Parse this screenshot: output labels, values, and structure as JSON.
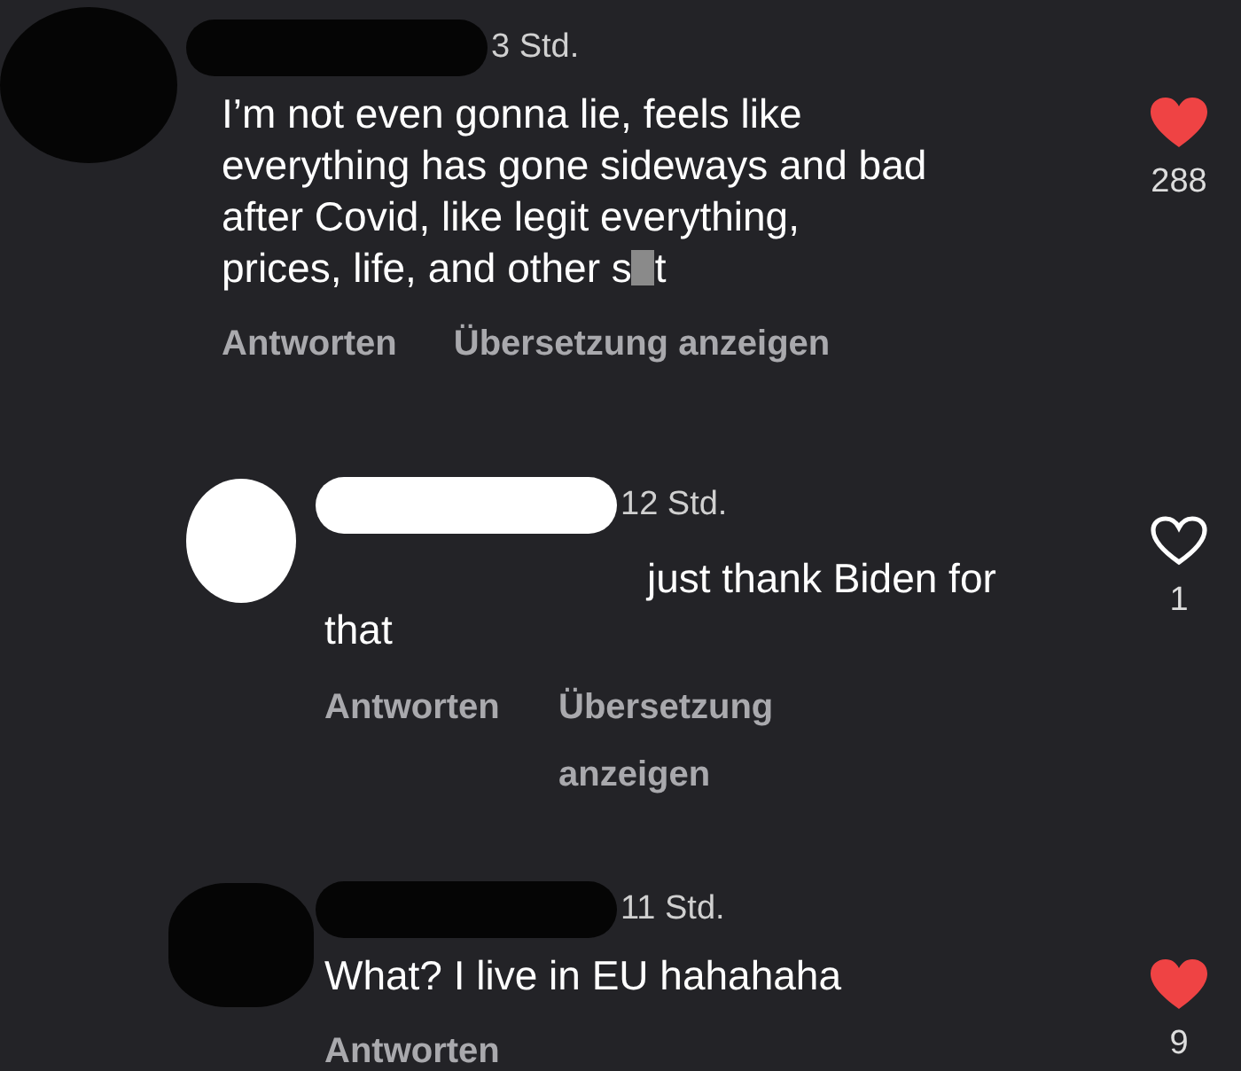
{
  "comments": [
    {
      "kind": "comment",
      "color": "#050505",
      "time": "3 Std.",
      "body": "I’m not even gonna lie, feels like everything has gone sideways and bad after Covid, like legit everything, prices, life, and other s",
      "censored": true,
      "body_end": "t",
      "actions": [
        "Antworten",
        "Übersetzung anzeigen"
      ],
      "liked": true,
      "likes": "288"
    },
    {
      "kind": "reply",
      "color": "#ffffff",
      "time": "12 Std.",
      "body": "just thank Biden for that",
      "actions": [
        "Antworten",
        "Übersetzung anzeigen"
      ],
      "liked": false,
      "likes": "1"
    },
    {
      "kind": "reply",
      "color": "#050505",
      "time": "11 Std.",
      "body": "What? I live in EU hahahaha",
      "actions": [
        "Antworten"
      ],
      "liked": true,
      "likes": "9"
    }
  ]
}
